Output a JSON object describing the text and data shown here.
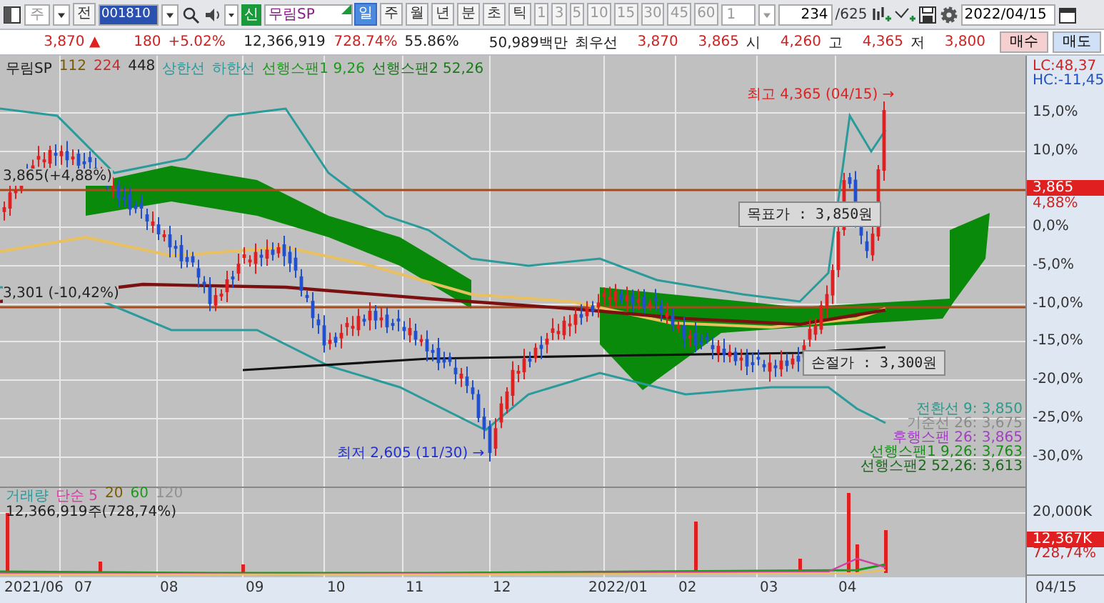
{
  "toolbar": {
    "market_select": "주",
    "prev_button": "전",
    "code": "001810",
    "badge": "신",
    "name": "무림SP",
    "periods": [
      {
        "label": "일",
        "selected": true
      },
      {
        "label": "주",
        "selected": false
      },
      {
        "label": "월",
        "selected": false
      },
      {
        "label": "년",
        "selected": false
      },
      {
        "label": "분",
        "selected": false
      },
      {
        "label": "초",
        "selected": false
      },
      {
        "label": "틱",
        "selected": false
      }
    ],
    "intervals": [
      {
        "label": "1",
        "disabled": true
      },
      {
        "label": "3",
        "disabled": true
      },
      {
        "label": "5",
        "disabled": true
      },
      {
        "label": "10",
        "disabled": true
      },
      {
        "label": "15",
        "disabled": true
      },
      {
        "label": "30",
        "disabled": true
      },
      {
        "label": "45",
        "disabled": true
      },
      {
        "label": "60",
        "disabled": true
      }
    ],
    "interval_select": "1",
    "page": "234",
    "page_total": "/625",
    "date": "2022/04/15"
  },
  "quote_bar": {
    "price": "3,870",
    "arrow": "▲",
    "change": "180",
    "change_pct": "+5.02%",
    "volume": "12,366,919",
    "volume_ratio": "728.74%",
    "turnover": "55.86%",
    "amount": "50,989백만",
    "best_label": "최우선",
    "ask": "3,870",
    "bid": "3,865",
    "ohl": [
      {
        "label": "시",
        "value": "4,260"
      },
      {
        "label": "고",
        "value": "4,365"
      },
      {
        "label": "저",
        "value": "3,800"
      }
    ],
    "buy": "매수",
    "sell": "매도"
  },
  "chart": {
    "legend": [
      {
        "text": "무림SP",
        "color": "#202020"
      },
      {
        "text": "112",
        "color": "#7a5a00"
      },
      {
        "text": "224",
        "color": "#c03030"
      },
      {
        "text": "448",
        "color": "#202020"
      },
      {
        "text": "상한선",
        "color": "#2a9a9a"
      },
      {
        "text": "하한선",
        "color": "#2a9a9a"
      },
      {
        "text": "선행스팬1 9,26",
        "color": "#1a9a1a"
      },
      {
        "text": "선행스팬2 52,26",
        "color": "#1a7a1a"
      }
    ],
    "price_labels": [
      "3,865(+4,88%)",
      "3,301 (-10,42%)"
    ],
    "annotations": [
      {
        "kind": "high",
        "text": "최고 4,365 (04/15) →"
      },
      {
        "kind": "target",
        "text": "목표가 : 3,850원"
      },
      {
        "kind": "stop",
        "text": "손절가 : 3,300원"
      },
      {
        "kind": "low",
        "text": "최저 2,605 (11/30) →"
      }
    ],
    "ichimoku_values": [
      {
        "text": "전환선 9: 3,850",
        "color": "#2a9a8a"
      },
      {
        "text": "기준선 26: 3,675",
        "color": "#8a8a8a"
      },
      {
        "text": "후행스팬 26: 3,865",
        "color": "#a040c0"
      },
      {
        "text": "선행스팬1 9,26: 3,763",
        "color": "#1a8a1a"
      },
      {
        "text": "선행스팬2 52,26: 3,613",
        "color": "#1a6a1a"
      }
    ],
    "volume_legend": [
      {
        "text": "거래량",
        "color": "#2a9a9a"
      },
      {
        "text": "단순 5",
        "color": "#d040a0"
      },
      {
        "text": "20",
        "color": "#7a5a00"
      },
      {
        "text": "60",
        "color": "#1a9a1a"
      },
      {
        "text": "120",
        "color": "#909090"
      }
    ],
    "volume_reading": "12,366,919주(728,74%)",
    "y_axis": [
      {
        "text": "LC:48,37",
        "kind": "lc"
      },
      {
        "text": "HC:-11,45",
        "kind": "hc"
      },
      {
        "text": "15,0%",
        "kind": "tick"
      },
      {
        "text": "10,0%",
        "kind": "tick"
      },
      {
        "text": "3,865",
        "kind": "tag"
      },
      {
        "text": "4,88%",
        "kind": "pct"
      },
      {
        "text": "0,0%",
        "kind": "tick"
      },
      {
        "text": "-5,0%",
        "kind": "tick"
      },
      {
        "text": "-10,0%",
        "kind": "tick"
      },
      {
        "text": "-15,0%",
        "kind": "tick"
      },
      {
        "text": "-20,0%",
        "kind": "tick"
      },
      {
        "text": "-25,0%",
        "kind": "tick"
      },
      {
        "text": "-30,0%",
        "kind": "tick"
      },
      {
        "text": "20,000K",
        "kind": "tick"
      },
      {
        "text": "12,367K",
        "kind": "tag"
      },
      {
        "text": "728,74%",
        "kind": "pct"
      }
    ],
    "x_axis": [
      "2021/06",
      "07",
      "08",
      "09",
      "10",
      "11",
      "12",
      "2022/01",
      "02",
      "03",
      "04"
    ],
    "last_date": "04/15"
  }
}
